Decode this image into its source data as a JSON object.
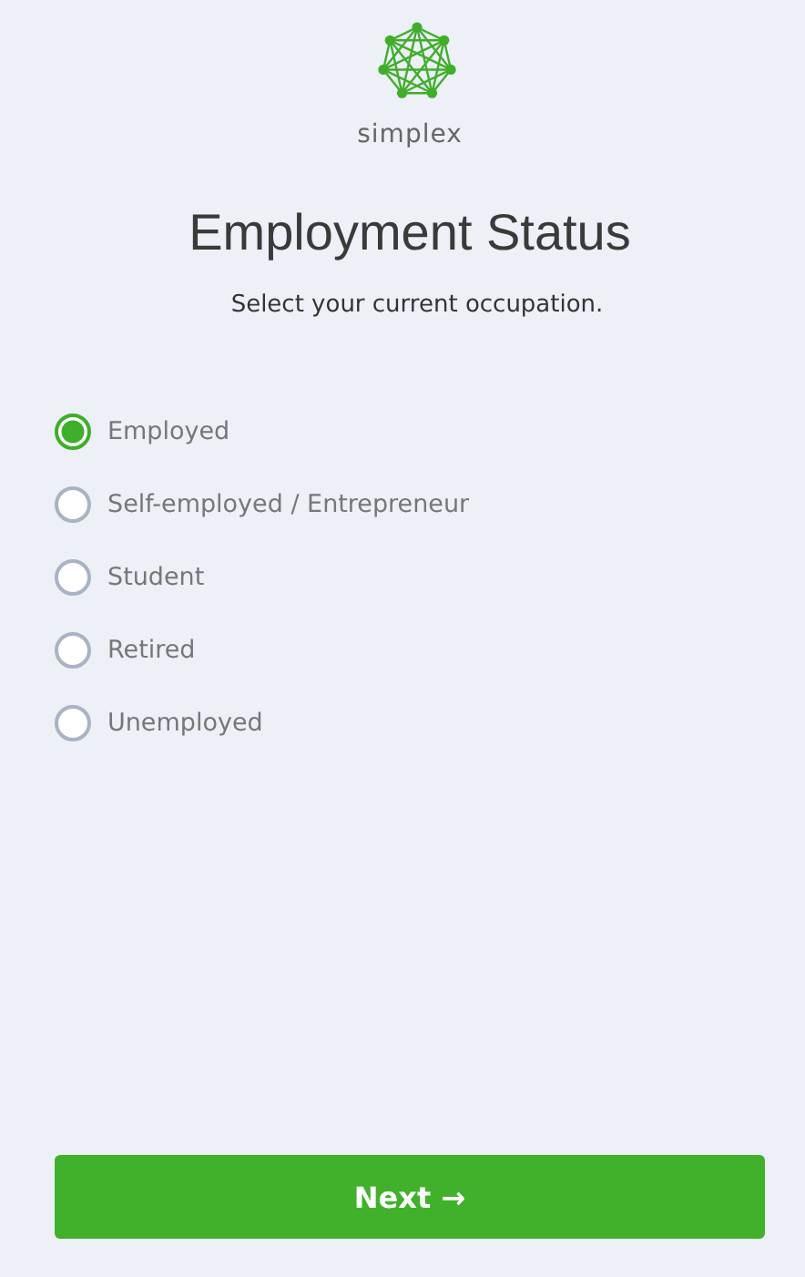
{
  "brand": {
    "name": "simplex"
  },
  "title": "Employment Status",
  "subtitle": "Select your current occupation.",
  "options": [
    {
      "label": "Employed",
      "selected": true
    },
    {
      "label": "Self-employed / Entrepreneur",
      "selected": false
    },
    {
      "label": "Student",
      "selected": false
    },
    {
      "label": "Retired",
      "selected": false
    },
    {
      "label": "Unemployed",
      "selected": false
    }
  ],
  "next_button": {
    "label": "Next →"
  }
}
